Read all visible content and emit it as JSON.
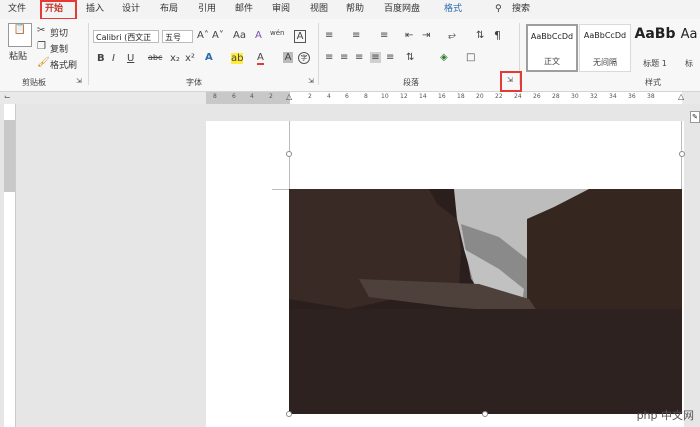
{
  "tabs": [
    {
      "label": "文件",
      "active": false
    },
    {
      "label": "开始",
      "active": true
    },
    {
      "label": "插入",
      "active": false
    },
    {
      "label": "设计",
      "active": false
    },
    {
      "label": "布局",
      "active": false
    },
    {
      "label": "引用",
      "active": false
    },
    {
      "label": "邮件",
      "active": false
    },
    {
      "label": "审阅",
      "active": false
    },
    {
      "label": "视图",
      "active": false
    },
    {
      "label": "帮助",
      "active": false
    },
    {
      "label": "百度网盘",
      "active": false
    },
    {
      "label": "格式",
      "active": false
    }
  ],
  "search_label": "搜索",
  "clipboard": {
    "paste": "粘贴",
    "cut": "剪切",
    "copy": "复制",
    "format_painter": "格式刷",
    "group": "剪贴板"
  },
  "font": {
    "name": "Calibri (西文正",
    "size": "五号",
    "group": "字体",
    "bold": "B",
    "italic": "I",
    "underline": "U",
    "strike": "abc",
    "sub": "x₂",
    "sup": "x²",
    "grow": "A˄",
    "shrink": "A˅",
    "case": "Aa",
    "clear": "A",
    "phonetic": "wén",
    "border": "A",
    "color": "A",
    "highlight": "ab"
  },
  "paragraph": {
    "group": "段落"
  },
  "styles": {
    "group": "样式",
    "items": [
      {
        "preview": "AaBbCcDd",
        "name": "正文"
      },
      {
        "preview": "AaBbCcDd",
        "name": "无间隔"
      },
      {
        "preview": "AaBb",
        "name": "标题 1"
      },
      {
        "preview": "Aa",
        "name": "标"
      }
    ]
  },
  "ruler": {
    "left_numbers": [
      "8",
      "6",
      "4",
      "2"
    ],
    "right_numbers": [
      "2",
      "4",
      "6",
      "8",
      "10",
      "12",
      "14",
      "16",
      "18",
      "20",
      "22",
      "24",
      "26",
      "28",
      "30",
      "32",
      "34",
      "36",
      "38"
    ]
  },
  "watermark": "php 中文网",
  "colors": {
    "accent": "#c0392b",
    "highlight_box": "#e53935"
  }
}
